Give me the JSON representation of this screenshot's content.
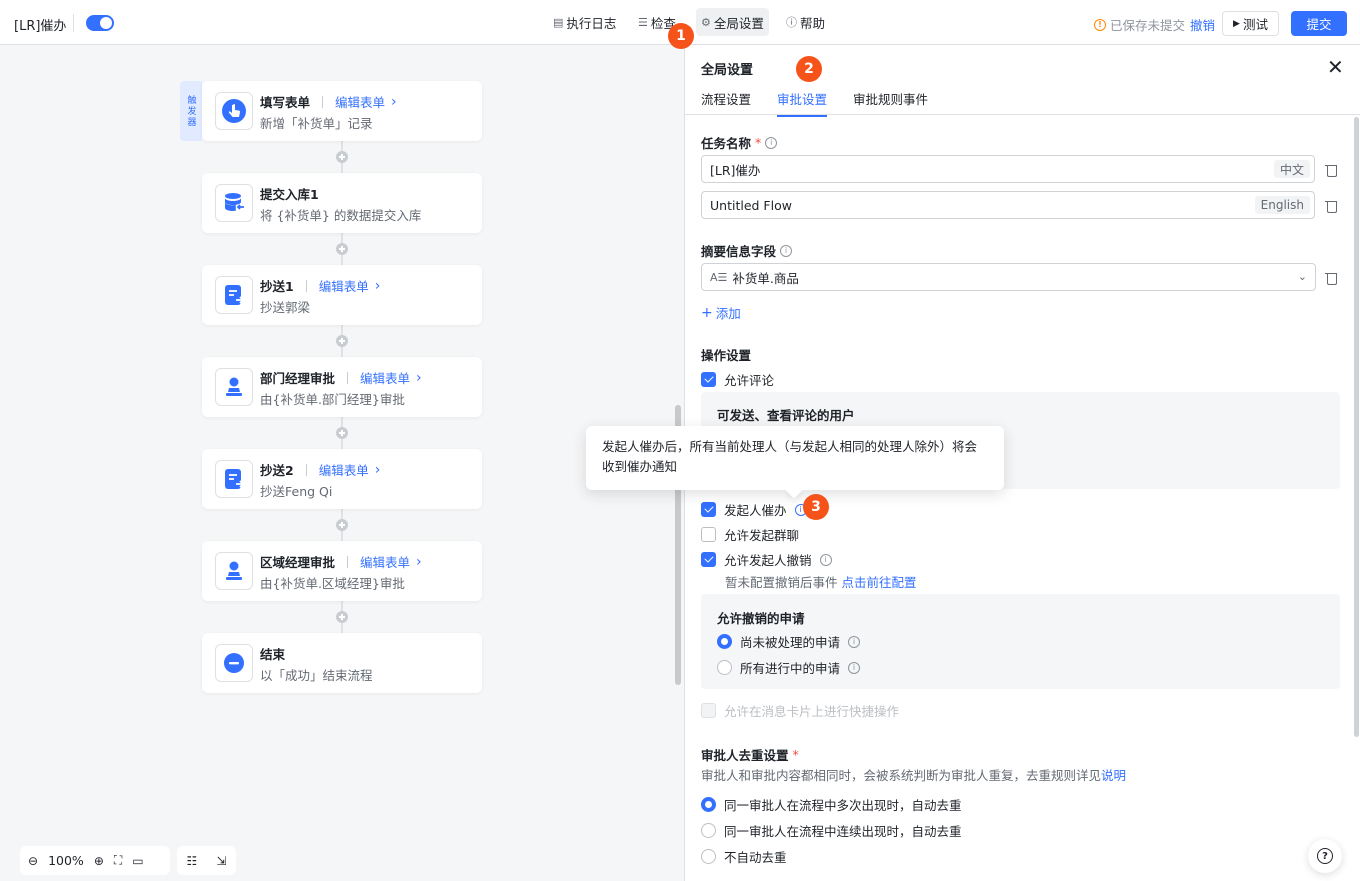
{
  "header": {
    "title": "[LR]催办",
    "toggle_on": true,
    "nav": [
      {
        "label": "执行日志",
        "icon": "log-icon"
      },
      {
        "label": "检查",
        "icon": "check-list-icon"
      },
      {
        "label": "全局设置",
        "icon": "gear-icon"
      },
      {
        "label": "帮助",
        "icon": "help-icon"
      }
    ],
    "status": "已保存未提交",
    "undo": "撤销",
    "test": "测试",
    "submit": "提交"
  },
  "badges": [
    "1",
    "2",
    "3"
  ],
  "flow": {
    "trigger_label": "触发器",
    "nodes": [
      {
        "title": "填写表单",
        "link": "编辑表单",
        "subtitle": "新增「补货单」记录",
        "icon": "hand-tap-icon"
      },
      {
        "title": "提交入库1",
        "link": "",
        "subtitle": "将 {补货单} 的数据提交入库",
        "icon": "database-icon"
      },
      {
        "title": "抄送1",
        "link": "编辑表单",
        "subtitle": "抄送郭梁",
        "icon": "cc-icon"
      },
      {
        "title": "部门经理审批",
        "link": "编辑表单",
        "subtitle": "由{补货单.部门经理}审批",
        "icon": "approver-icon"
      },
      {
        "title": "抄送2",
        "link": "编辑表单",
        "subtitle": "抄送Feng Qi",
        "icon": "cc-icon"
      },
      {
        "title": "区域经理审批",
        "link": "编辑表单",
        "subtitle": "由{补货单.区域经理}审批",
        "icon": "approver-icon"
      },
      {
        "title": "结束",
        "link": "",
        "subtitle": "以「成功」结束流程",
        "icon": "end-icon"
      }
    ]
  },
  "zoom": {
    "level": "100%"
  },
  "panel": {
    "title": "全局设置",
    "tabs": [
      "流程设置",
      "审批设置",
      "审批规则事件"
    ],
    "active_tab": 1,
    "task_name": {
      "label": "任务名称",
      "zh_value": "[LR]催办",
      "zh_tag": "中文",
      "en_value": "Untitled Flow",
      "en_tag": "English"
    },
    "summary": {
      "label": "摘要信息字段",
      "value": "补货单.商品",
      "add": "添加"
    },
    "ops": {
      "label": "操作设置",
      "allow_comment": "允许评论",
      "comment_users_title": "可发送、查看评论的用户",
      "initiator_urge": "发起人催办",
      "allow_group_chat": "允许发起群聊",
      "allow_revoke": "允许发起人撤销",
      "revoke_hint": "暂未配置撤销后事件",
      "revoke_hint_link": "点击前往配置",
      "revoke_scope_title": "允许撤销的申请",
      "revoke_opt1": "尚未被处理的申请",
      "revoke_opt2": "所有进行中的申请",
      "quick_action": "允许在消息卡片上进行快捷操作"
    },
    "dedup": {
      "label": "审批人去重设置",
      "desc": "审批人和审批内容都相同时，会被系统判断为审批人重复，去重规则详见",
      "desc_link": "说明",
      "opt1": "同一审批人在流程中多次出现时，自动去重",
      "opt2": "同一审批人在流程中连续出现时，自动去重",
      "opt3": "不自动去重"
    }
  },
  "tooltip": {
    "text": "发起人催办后，所有当前处理人（与发起人相同的处理人除外）将会收到催办通知"
  }
}
